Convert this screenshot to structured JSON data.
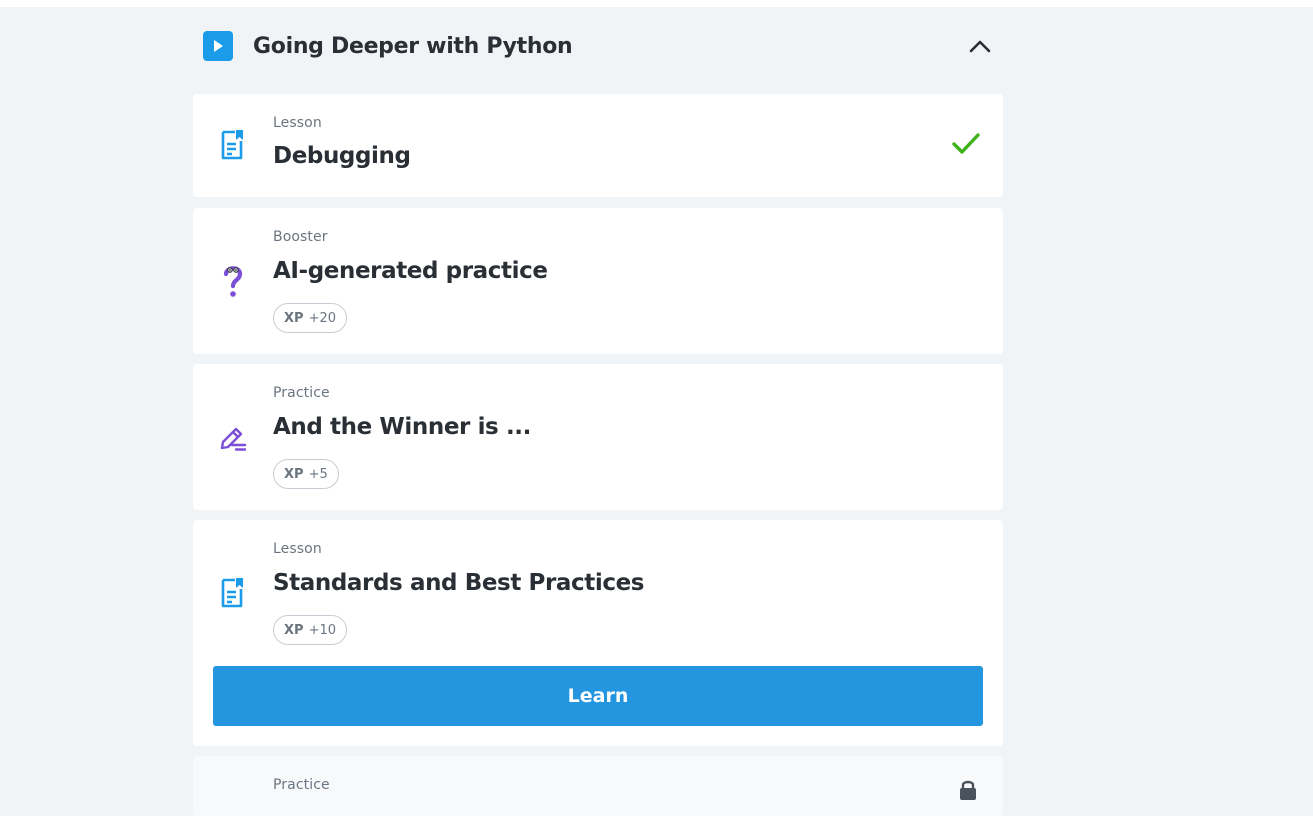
{
  "module": {
    "title": "Going Deeper with Python",
    "icon": "play-icon",
    "toggle_icon": "chevron-up-icon"
  },
  "items": [
    {
      "kind": "Lesson",
      "title": "Debugging",
      "icon": "lesson-document-icon",
      "status": "completed"
    },
    {
      "kind": "Booster",
      "title": "AI-generated practice",
      "icon": "question-mark-icon",
      "xp_label": "XP",
      "xp_value": "+20"
    },
    {
      "kind": "Practice",
      "title": "And the Winner is ...",
      "icon": "pencil-icon",
      "xp_label": "XP",
      "xp_value": "+5"
    },
    {
      "kind": "Lesson",
      "title": "Standards and Best Practices",
      "icon": "lesson-document-icon",
      "xp_label": "XP",
      "xp_value": "+10",
      "action_label": "Learn"
    },
    {
      "kind": "Practice",
      "icon": "lock-icon",
      "status": "locked"
    }
  ],
  "colors": {
    "accent": "#2496e0",
    "check": "#3db21a",
    "booster": "#7b4fd6",
    "background": "#f1f4f7"
  }
}
